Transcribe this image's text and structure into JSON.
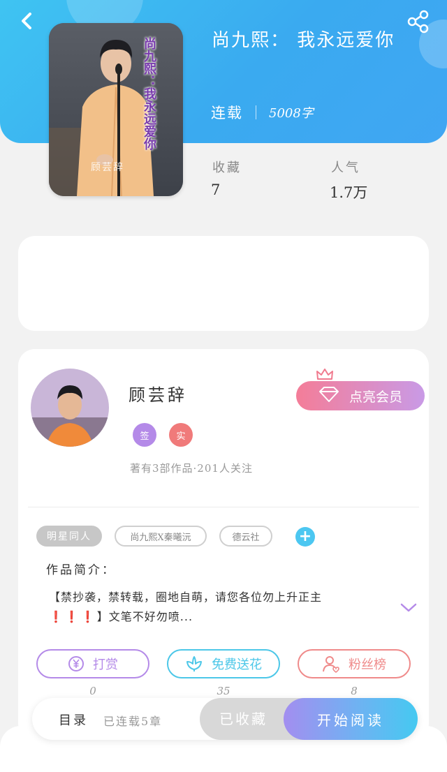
{
  "header": {
    "book_title": "尚九熙： 我永远爱你",
    "status": "连载",
    "word_count": "5008字",
    "cover_overlay_text": "尚九熙：我永远爱你",
    "cover_watermark": "顾芸辞"
  },
  "stats": [
    {
      "label": "收藏",
      "value": "7"
    },
    {
      "label": "人气",
      "value": "1.7万"
    }
  ],
  "author": {
    "name": "顾芸辞",
    "badges": [
      {
        "text": "签",
        "color": "#b48ae8"
      },
      {
        "text": "实",
        "color": "#f07a7a"
      }
    ],
    "meta": "著有3部作品·201人关注",
    "vip_button": "点亮会员"
  },
  "tags": [
    "明星同人",
    "尚九熙X秦曦沅",
    "德云社"
  ],
  "intro": {
    "label": "作品简介：",
    "line1": "【禁抄袭，禁转载，圈地自萌，请您各位勿上升正主",
    "marks": "❗❗❗",
    "line2": "】文笔不好勿喷..."
  },
  "actions": [
    {
      "label": "打赏",
      "count": "0",
      "color": "#b48ae8",
      "icon": "yen-coin-icon"
    },
    {
      "label": "免费送花",
      "count": "35",
      "color": "#4cc7e8",
      "icon": "flower-icon"
    },
    {
      "label": "粉丝榜",
      "count": "8",
      "color": "#ef8a8a",
      "icon": "fan-user-icon"
    }
  ],
  "bottom_bar": {
    "toc": "目录",
    "serial_count": "已连载5章",
    "collected": "已收藏",
    "read": "开始阅读"
  },
  "colors": {
    "header_blue": "#3aaaf0",
    "accent_cyan": "#4cc7f1",
    "vip_pink": "#f47d98",
    "vip_purple": "#c99ae6"
  }
}
